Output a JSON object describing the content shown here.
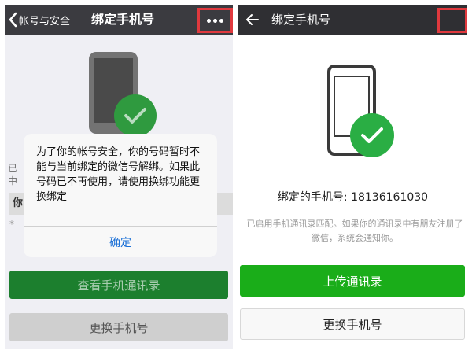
{
  "left": {
    "back_label": "帐号与安全",
    "title": "绑定手机号",
    "partial_line1": "已",
    "partial_line2": "中",
    "partial_row": "你",
    "partial_row2": "*",
    "dialog": {
      "message": "为了你的帐号安全，你的号码暂时不能与当前绑定的微信号解绑。如果此号码已不再使用，请使用换绑功能更换绑定",
      "confirm": "确定"
    },
    "view_contacts_button": "查看手机通讯录",
    "change_phone_button": "更换手机号"
  },
  "right": {
    "title": "绑定手机号",
    "bound_phone_label": "绑定的手机号: 18136161030",
    "note": "已启用手机通讯录匹配。如果你的通讯录中有朋友注册了微信，系统会通知你。",
    "upload_contacts_button": "上传通讯录",
    "change_phone_button": "更换手机号"
  },
  "colors": {
    "highlight_red": "#e0393e",
    "wechat_green": "#1aad19",
    "link_blue": "#1a6fd6"
  },
  "icons": [
    "back-chevron-icon",
    "more-dots-icon",
    "back-arrow-icon",
    "phone-icon",
    "check-icon"
  ]
}
